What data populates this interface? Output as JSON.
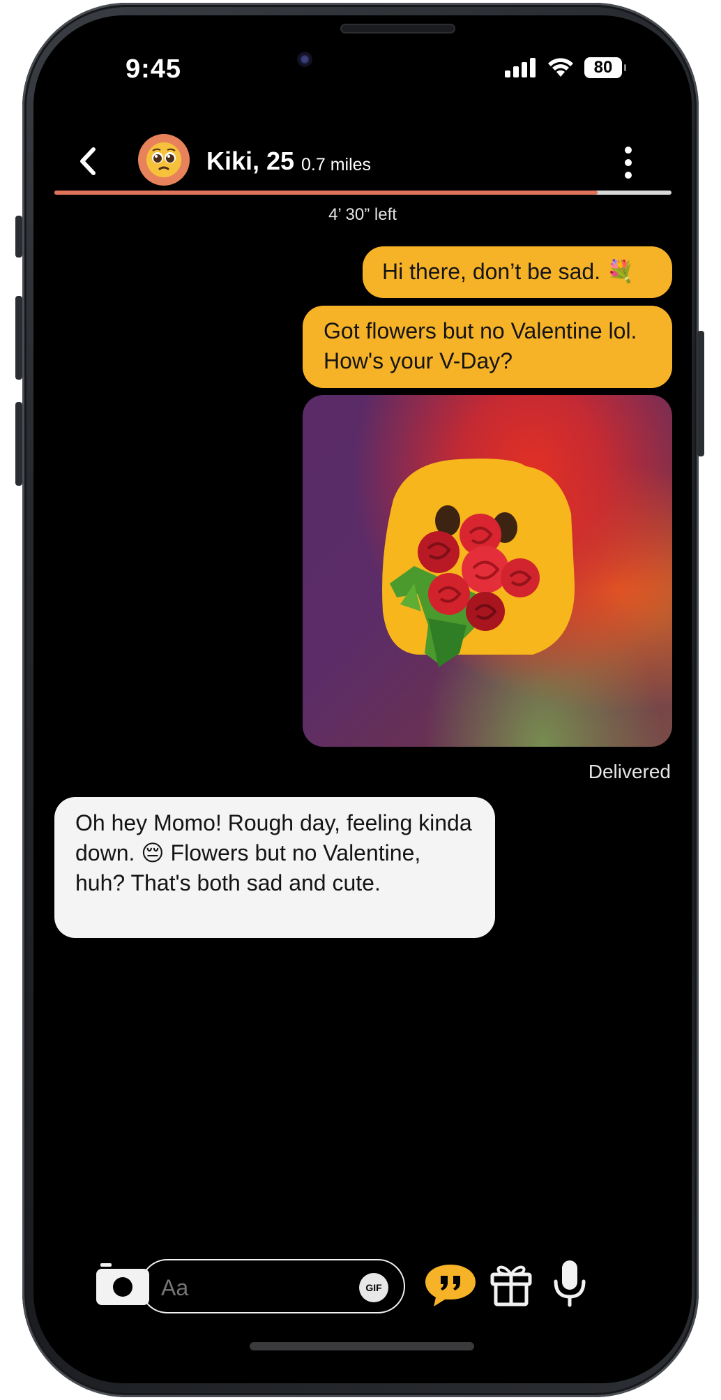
{
  "status_bar": {
    "time": "9:45",
    "battery": "80"
  },
  "header": {
    "name": "Kiki, 25",
    "distance": "0.7 miles",
    "avatar_emoji": "🥺"
  },
  "timer": {
    "label": "4’ 30” left",
    "progress_fraction": 0.88
  },
  "messages": [
    {
      "direction": "outgoing",
      "text": "Hi there, don’t be sad. 💐"
    },
    {
      "direction": "outgoing",
      "text": "Got flowers but no Valentine lol. How's your V-Day?"
    },
    {
      "direction": "outgoing",
      "type": "image",
      "depicts": "yellow blob emoji holding a rose bouquet"
    },
    {
      "direction": "incoming",
      "text": "Oh hey Momo! Rough day, feeling kinda down. 😔 Flowers but no Valentine, huh? That's both sad and cute."
    }
  ],
  "delivery_status": "Delivered",
  "composer": {
    "placeholder": "Aa",
    "gif_label": "GIF"
  },
  "icons": {
    "back": "chevron-left-icon",
    "more": "more-vertical-icon",
    "camera": "camera-icon",
    "quote": "quote-bubble-icon",
    "gift": "gift-icon",
    "mic": "microphone-icon",
    "signal": "cellular-signal-icon",
    "wifi": "wifi-icon"
  },
  "colors": {
    "outgoing_bubble": "#f7b328",
    "incoming_bubble": "#f4f4f4",
    "progress": "#e0745a",
    "background": "#000000"
  }
}
